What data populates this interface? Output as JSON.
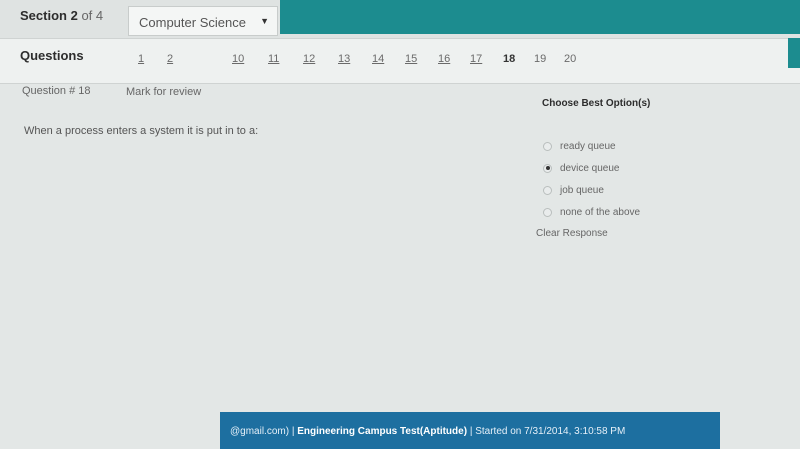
{
  "header": {
    "section_word": "Section",
    "section_number": "2",
    "section_of": "of 4",
    "subject": "Computer Science"
  },
  "questions_bar": {
    "title": "Questions",
    "numbers": [
      "1",
      "2",
      "10",
      "11",
      "12",
      "13",
      "14",
      "15",
      "16",
      "17",
      "18",
      "19",
      "20"
    ],
    "current": "18"
  },
  "question": {
    "number_label": "Question # 18",
    "mark_for_review": "Mark for review",
    "text": "When a process enters a system it is put in to a:"
  },
  "options_panel": {
    "title": "Choose Best Option(s)",
    "options": [
      {
        "label": "ready queue",
        "selected": false
      },
      {
        "label": "device queue",
        "selected": true
      },
      {
        "label": "job queue",
        "selected": false
      },
      {
        "label": "none of the above",
        "selected": false
      }
    ],
    "clear_response": "Clear Response"
  },
  "footer": {
    "email_part": "@gmail.com)",
    "test_name": "Engineering Campus Test(Aptitude)",
    "started": "Started on 7/31/2014, 3:10:58 PM"
  },
  "colors": {
    "accent": "#1c8c8f",
    "footer": "#1d6fa0"
  }
}
